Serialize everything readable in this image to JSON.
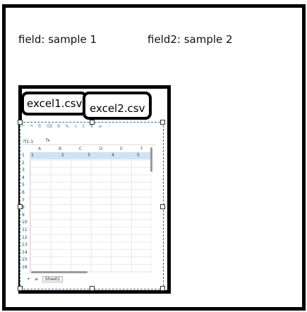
{
  "fields": [
    {
      "label": "field: sample 1"
    },
    {
      "label": "field2: sample 2"
    }
  ],
  "tabs": [
    {
      "label": "excel1.csv"
    },
    {
      "label": "excel2.csv"
    }
  ],
  "sheet": {
    "toolbar": [
      "↶",
      "↷",
      "⎘",
      "⌫",
      "B",
      "%",
      "↓",
      "Σ",
      "⇅",
      "≡",
      "⋯"
    ],
    "cell_ref": "가1:1",
    "fx_label": "fx",
    "columns": [
      "A",
      "B",
      "C",
      "D",
      "E",
      "F"
    ],
    "rows": [
      "1",
      "2",
      "3",
      "4",
      "5",
      "6",
      "7",
      "8",
      "9",
      "10",
      "11",
      "12",
      "13",
      "14",
      "15",
      "16"
    ],
    "row1_values": [
      "1",
      "2",
      "3",
      "4",
      "5"
    ],
    "sheet_nav": [
      "+",
      "≡"
    ],
    "sheet_name": "Sheet1"
  }
}
